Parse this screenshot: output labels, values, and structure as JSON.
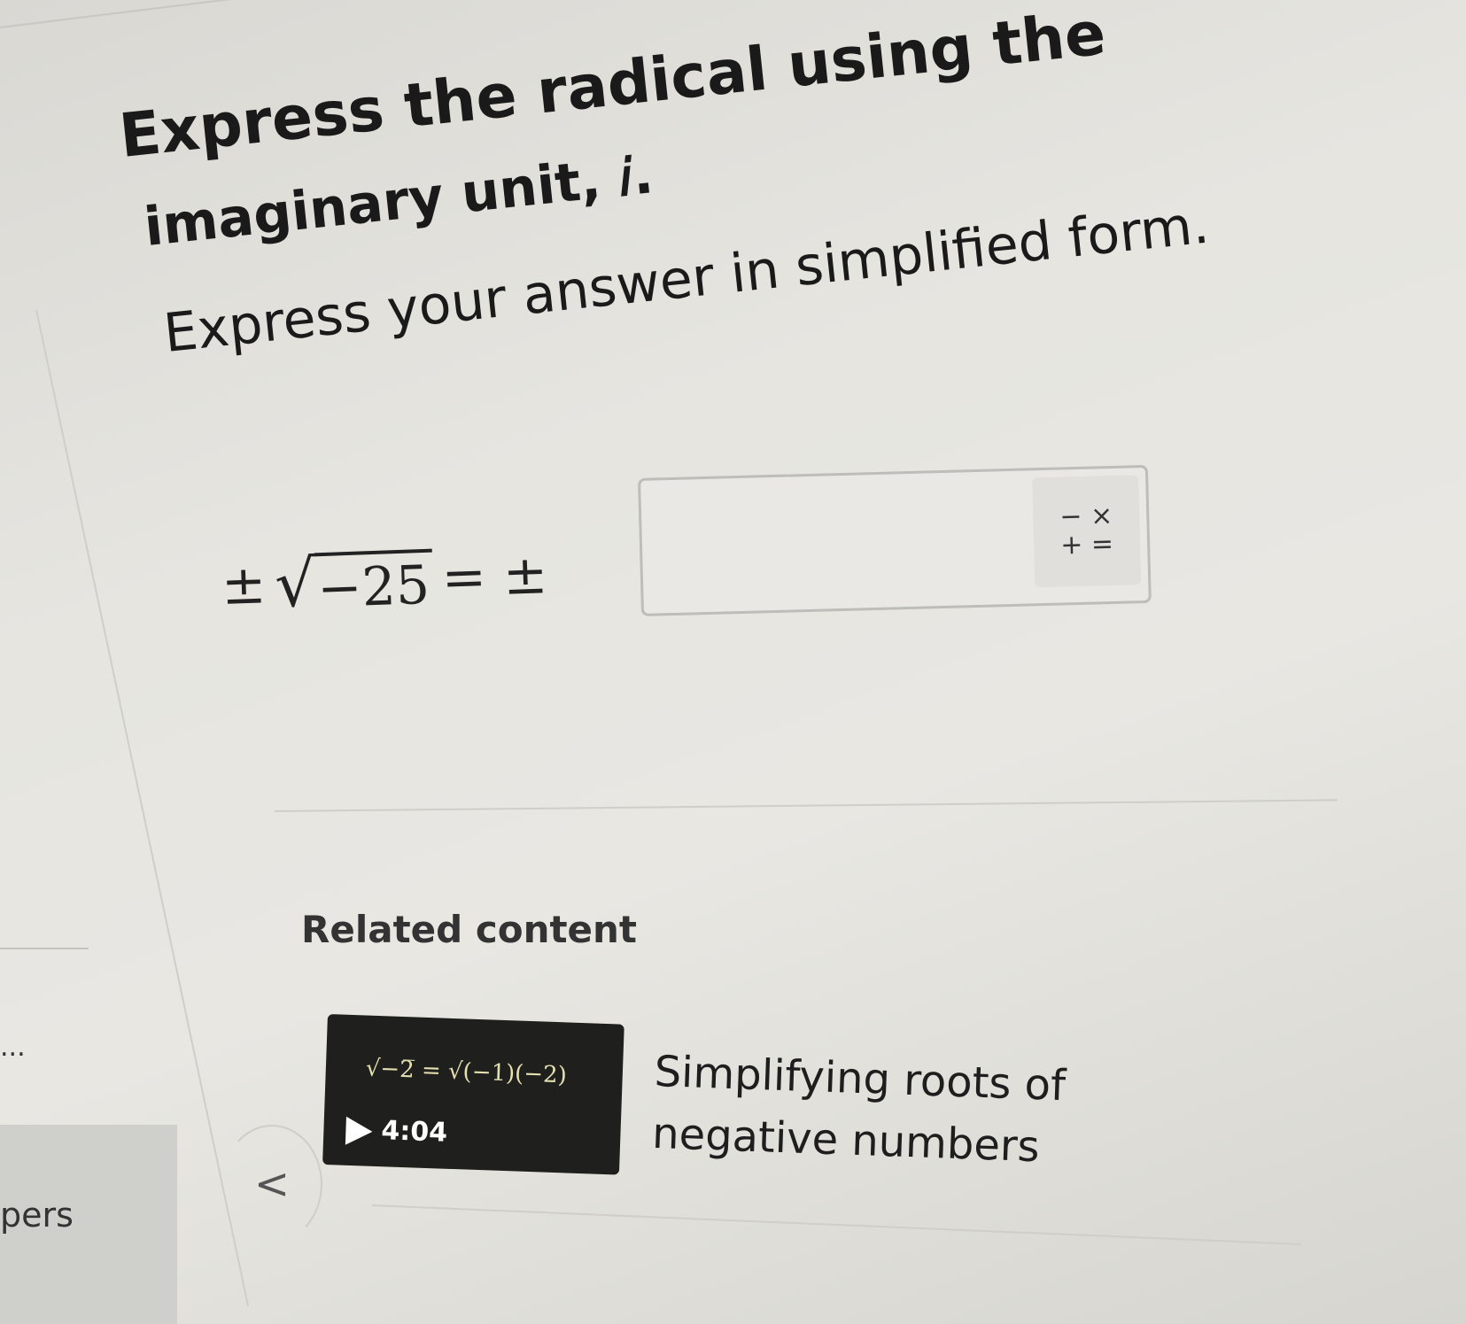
{
  "question": {
    "line1": "Express the radical using the",
    "line2": "imaginary unit, 𝑖.",
    "line3": "Express your answer in simplified form."
  },
  "equation": {
    "prefix": "±",
    "radicand": "−25",
    "equals": "= ±"
  },
  "answer": {
    "value": "",
    "keypad_top": "− ×",
    "keypad_bottom": "+ ="
  },
  "related": {
    "heading": "Related content",
    "video": {
      "thumbnail_formula": "√−2̅ = √(−1)(−2)",
      "duration": "4:04",
      "title_line1": "Simplifying roots of",
      "title_line2": "negative numbers"
    },
    "prev_label": "<"
  },
  "sidebar": {
    "ellipsis": "...",
    "partial_label": "pers"
  }
}
